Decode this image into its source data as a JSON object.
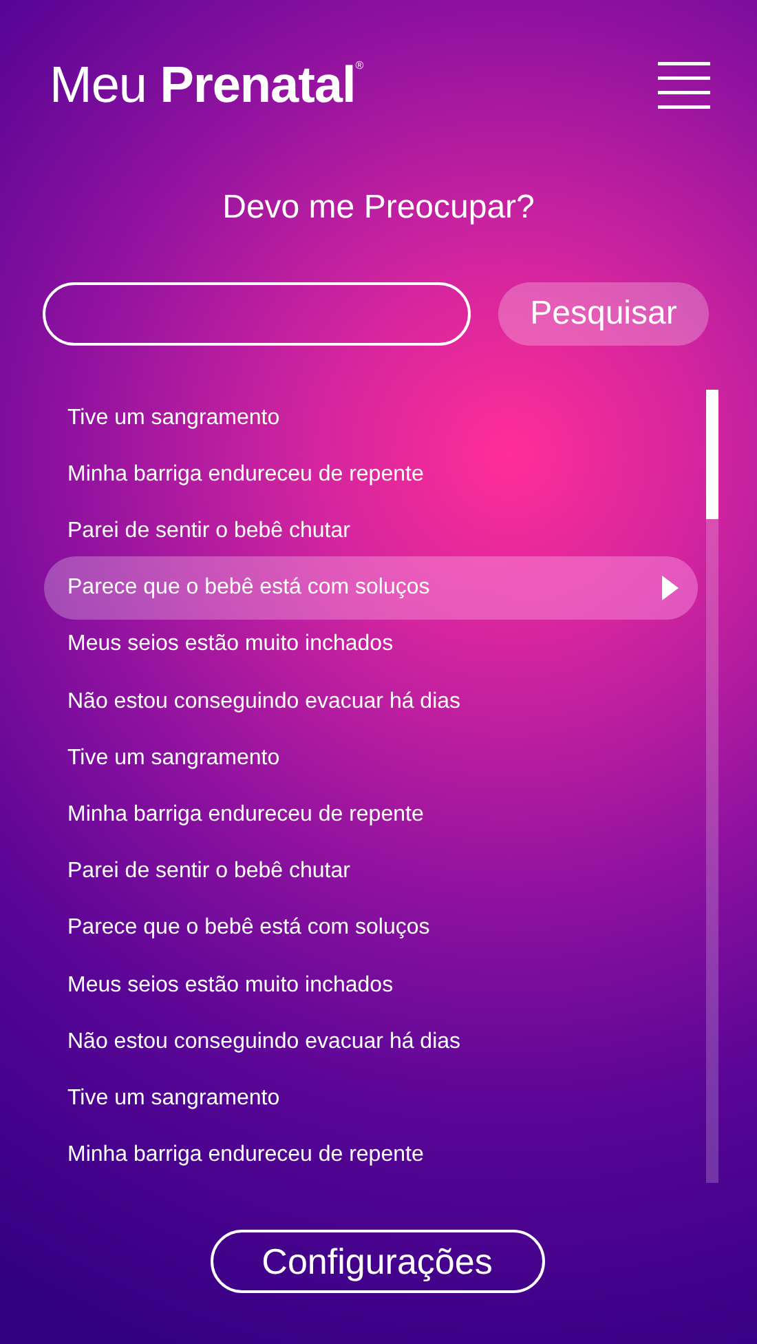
{
  "header": {
    "logo": "Meu **Prenatal**$^{®}$"
  },
  "title": "Devo me Preocupar?",
  "search": {
    "button": "Pesquisar"
  },
  "list": [
    {
      "label": "Tive um sangramento",
      "selected": false
    },
    {
      "label": "Minha barriga endureceu de repente",
      "selected": false
    },
    {
      "label": "Parei de sentir o bebê chutar",
      "selected": false
    },
    {
      "label": "Parece que o bebê está com soluços",
      "selected": true
    },
    {
      "label": "Meus seios estão muito inchados",
      "selected": false
    },
    {
      "label": "Não estou conseguindo evacuar há dias",
      "selected": false
    },
    {
      "label": "Tive um sangramento",
      "selected": false
    },
    {
      "label": "Minha barriga endureceu de repente",
      "selected": false
    },
    {
      "label": "Parei de sentir o bebê chutar",
      "selected": false
    },
    {
      "label": "Parece que o bebê está com soluços",
      "selected": false
    },
    {
      "label": "Meus seios estão muito inchados",
      "selected": false
    },
    {
      "label": "Não estou conseguindo evacuar há dias",
      "selected": false
    },
    {
      "label": "Tive um sangramento",
      "selected": false
    },
    {
      "label": "Minha barriga endureceu de repente",
      "selected": false
    }
  ],
  "footer_button": "Configurações"
}
